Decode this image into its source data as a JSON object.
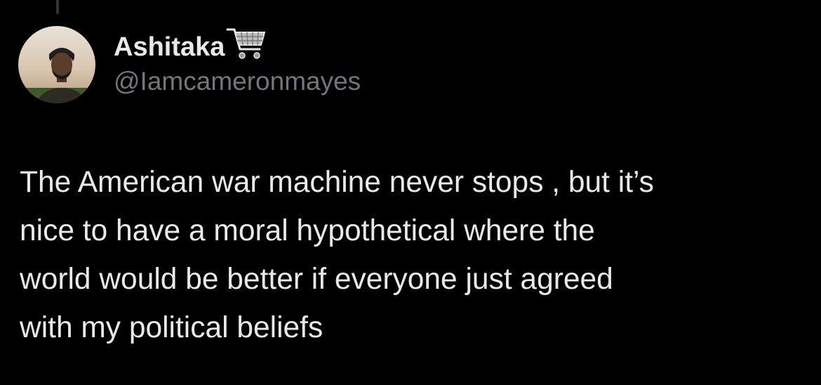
{
  "author": {
    "display_name": "Ashitaka",
    "handle": "@Iamcameronmayes",
    "name_emoji": "shopping-cart-icon"
  },
  "tweet": {
    "text": "The American war machine never stops , but it’s\nnice to have a moral hypothetical where the\nworld would be better if everyone just agreed\nwith my political beliefs"
  },
  "colors": {
    "background": "#000000",
    "primary_text": "#e7e9ea",
    "secondary_text": "#71767b",
    "thread_line": "#333639"
  }
}
